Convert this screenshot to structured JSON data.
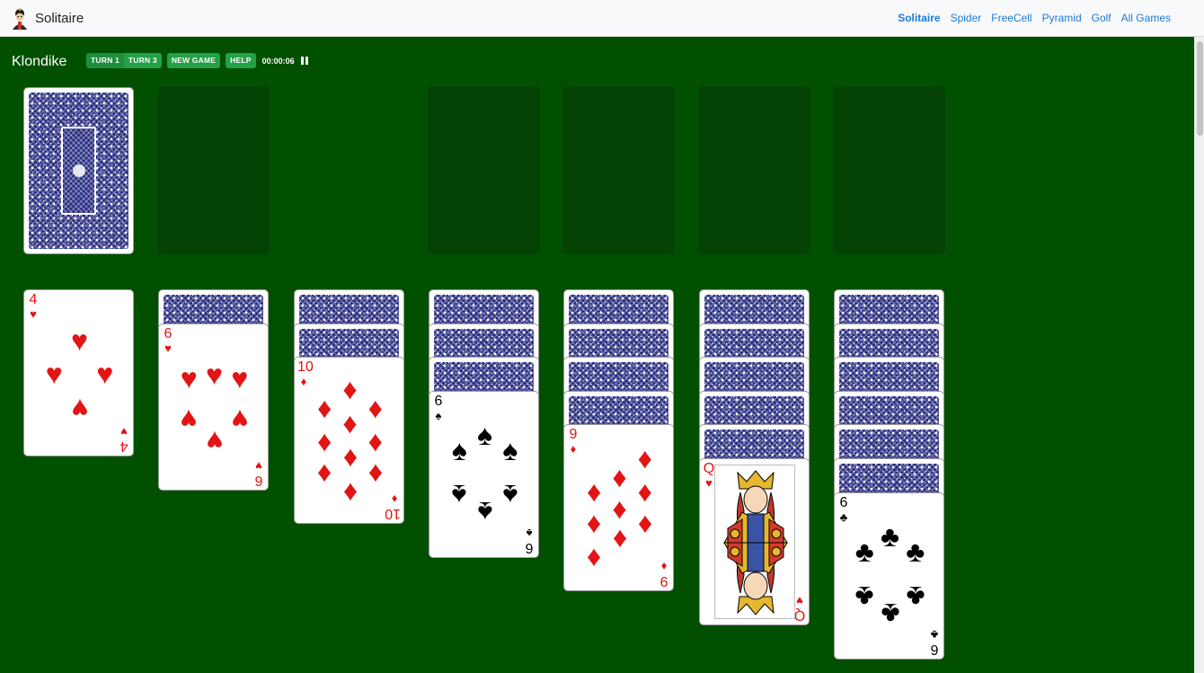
{
  "header": {
    "brand": "Solitaire",
    "nav": [
      {
        "label": "Solitaire",
        "active": true
      },
      {
        "label": "Spider",
        "active": false
      },
      {
        "label": "FreeCell",
        "active": false
      },
      {
        "label": "Pyramid",
        "active": false
      },
      {
        "label": "Golf",
        "active": false
      },
      {
        "label": "All Games",
        "active": false
      }
    ]
  },
  "toolbar": {
    "game_title": "Klondike",
    "turn1_label": "TURN 1",
    "turn3_label": "TURN 3",
    "new_game_label": "NEW GAME",
    "help_label": "HELP",
    "timer": "00:00:06"
  },
  "colors": {
    "felt": "#005000",
    "slot": "#044204",
    "button": "#24a047",
    "card_back": "#2c2f82",
    "red_suit": "#e31414",
    "link": "#1e7bd6"
  },
  "board": {
    "stock": {
      "face_down": 1
    },
    "waste": [],
    "foundations": [
      [],
      [],
      [],
      []
    ],
    "tableau": [
      {
        "face_down": 0,
        "face_up": [
          {
            "rank": "4",
            "suit": "hearts"
          }
        ]
      },
      {
        "face_down": 1,
        "face_up": [
          {
            "rank": "6",
            "suit": "hearts"
          }
        ]
      },
      {
        "face_down": 2,
        "face_up": [
          {
            "rank": "10",
            "suit": "diamonds"
          }
        ]
      },
      {
        "face_down": 3,
        "face_up": [
          {
            "rank": "6",
            "suit": "spades"
          }
        ]
      },
      {
        "face_down": 4,
        "face_up": [
          {
            "rank": "9",
            "suit": "diamonds"
          }
        ]
      },
      {
        "face_down": 5,
        "face_up": [
          {
            "rank": "Q",
            "suit": "hearts"
          }
        ]
      },
      {
        "face_down": 6,
        "face_up": [
          {
            "rank": "6",
            "suit": "clubs"
          }
        ]
      }
    ]
  }
}
